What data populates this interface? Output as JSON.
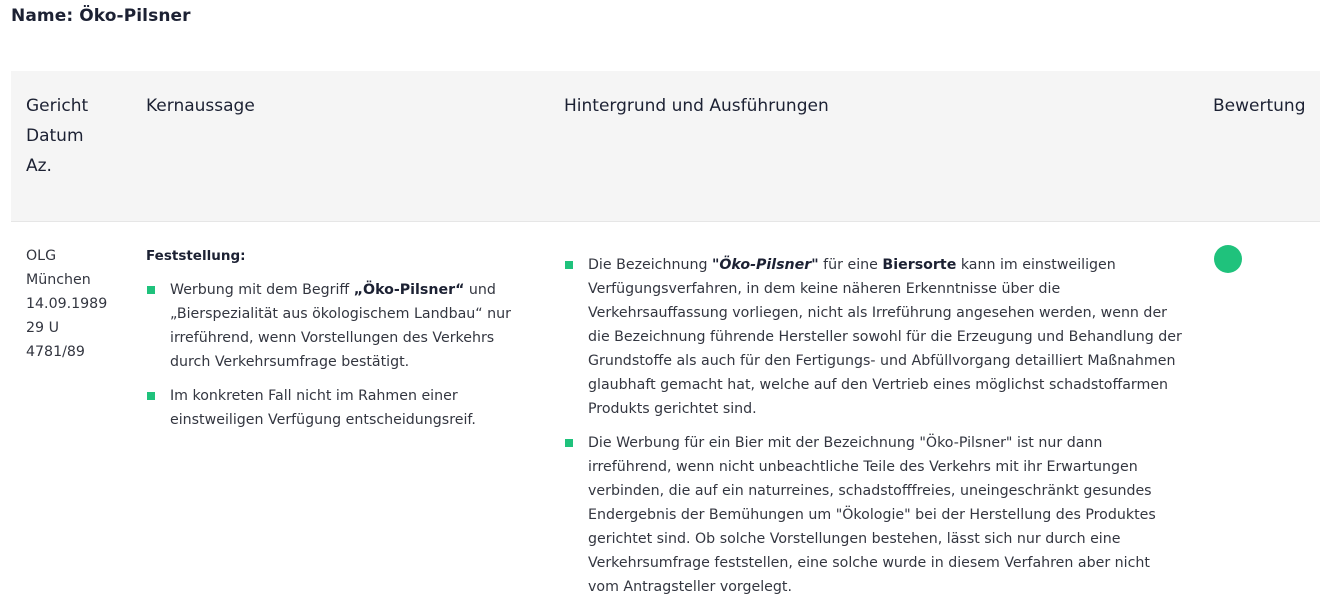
{
  "page": {
    "title": "Name: Öko-Pilsner"
  },
  "table": {
    "headers": {
      "court": [
        "Gericht",
        "Datum",
        "Az."
      ],
      "core": "Kernaussage",
      "background": "Hintergrund und Ausführungen",
      "rating": "Bewertung"
    },
    "row": {
      "court": [
        "OLG",
        "München",
        "14.09.1989",
        "29 U",
        "4781/89"
      ],
      "core_label": "Feststellung:",
      "core_items": [
        {
          "pre": "Werbung mit dem Begriff ",
          "strong": "„Öko-Pilsner“",
          "post": " und „Bierspezialität aus ökologischem Landbau“ nur irreführend, wenn Vorstellungen des Verkehrs durch Verkehrsumfrage bestätigt."
        },
        {
          "pre": "Im konkreten Fall nicht im Rahmen einer einstweiligen Verfügung entscheidungsreif.",
          "strong": "",
          "post": ""
        }
      ],
      "background_items": [
        {
          "a": "Die Bezeichnung ",
          "em": "\"Öko-Pilsner\"",
          "b": " für eine ",
          "strong": "Biersorte",
          "c": " kann im einstweiligen Verfügungsverfahren, in dem keine näheren Erkenntnisse über die Verkehrsauffassung vorliegen, nicht als Irreführung angesehen werden, wenn der die Bezeichnung führende Hersteller sowohl für die Erzeugung und Behandlung der Grundstoffe als auch für den Fertigungs- und Abfüllvorgang detailliert Maßnahmen glaubhaft gemacht hat, welche auf den Vertrieb eines möglichst schadstoffarmen Produkts gerichtet sind."
        },
        {
          "a": "Die Werbung für ein Bier mit der Bezeichnung \"Öko-Pilsner\" ist nur dann irreführend, wenn nicht unbeachtliche Teile des Verkehrs mit ihr Erwartungen verbinden, die auf ein naturreines, schadstofffreies, uneingeschränkt gesundes Endergebnis der Bemühungen um \"Ökologie\" bei der Herstellung des Produktes gerichtet sind. Ob solche Vorstellungen bestehen, lässt sich nur durch eine Verkehrsumfrage feststellen, eine solche wurde in diesem Verfahren aber nicht vom Antragsteller vorgelegt.",
          "em": "",
          "b": "",
          "strong": "",
          "c": ""
        }
      ],
      "rating_color": "#1fc27c",
      "rating_name": "green-rating-dot"
    }
  },
  "colors": {
    "accent": "#1fc27c",
    "header_bg": "#f5f5f5",
    "text": "#333640"
  }
}
